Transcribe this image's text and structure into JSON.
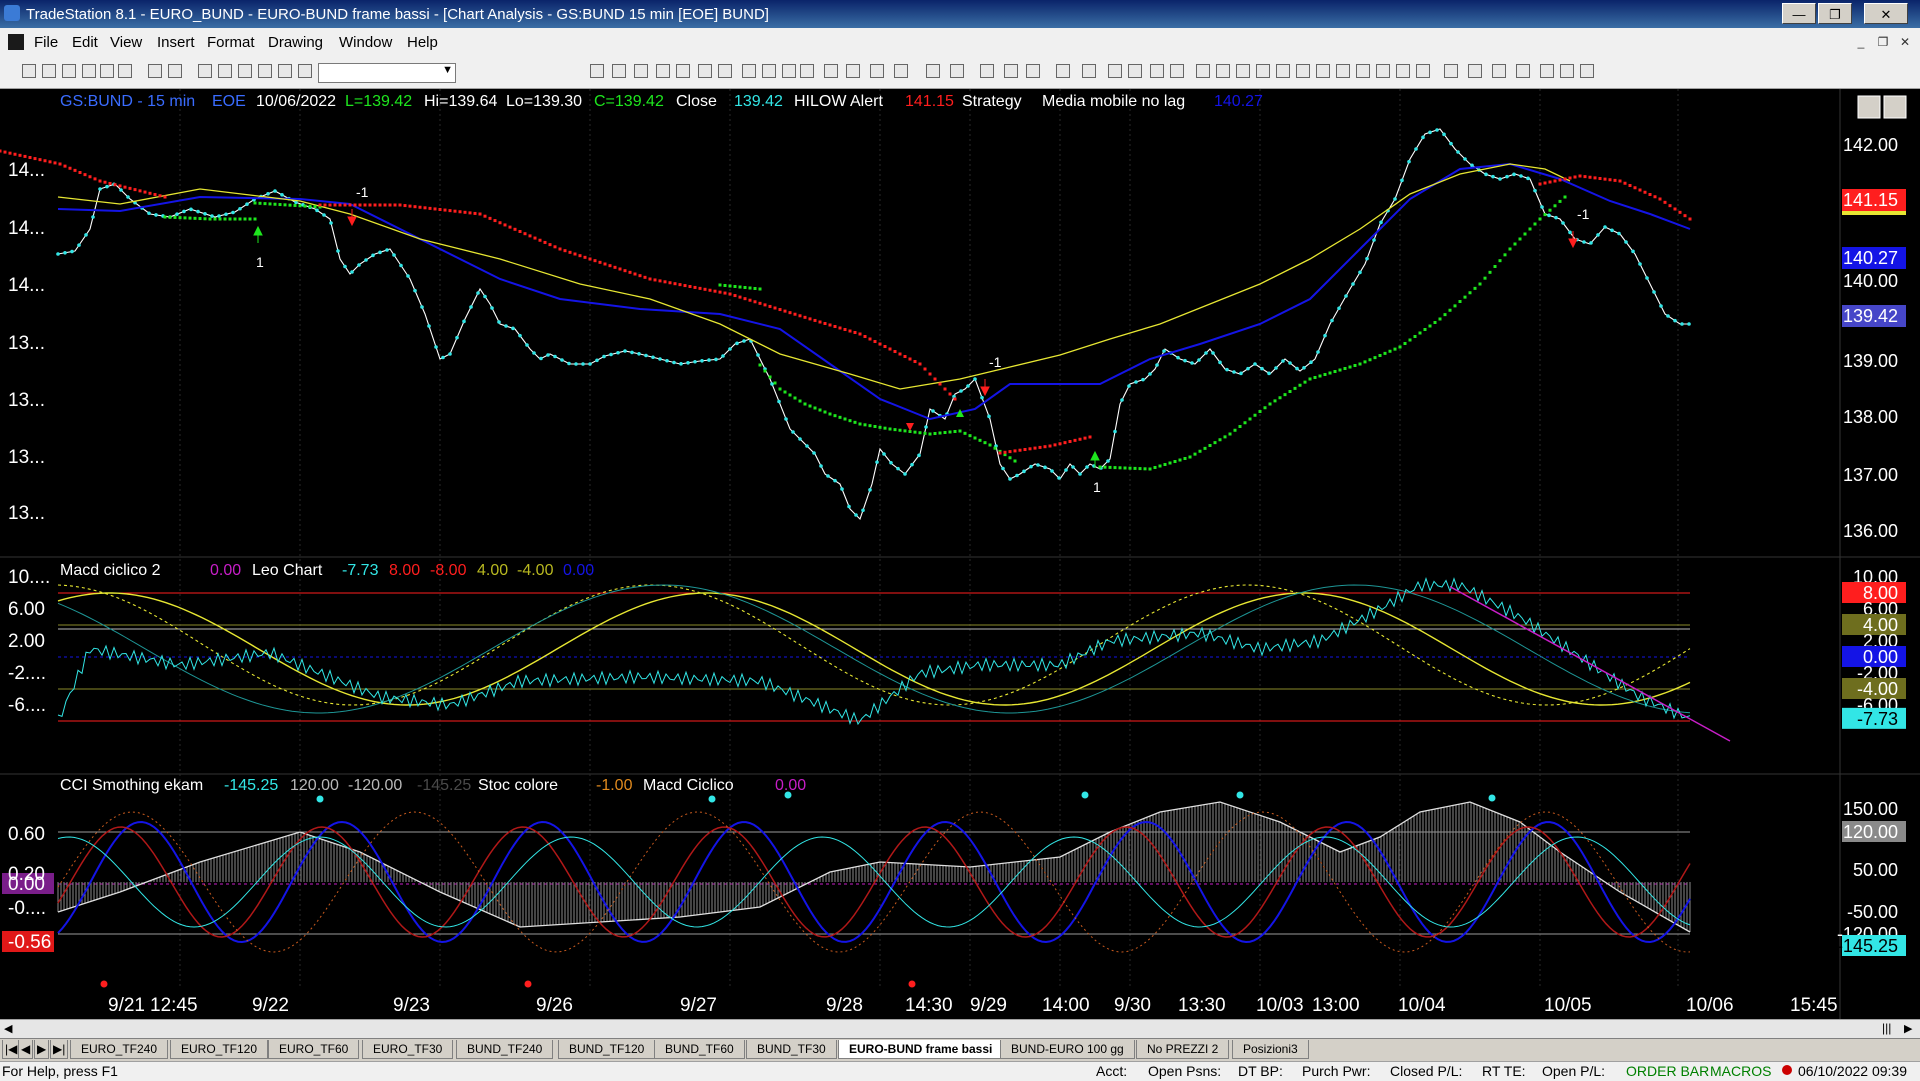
{
  "window": {
    "title": "TradeStation 8.1 - EURO_BUND - EURO-BUND frame bassi - [Chart Analysis - GS:BUND  15 min  [EOE] BUND]"
  },
  "menu": [
    "File",
    "Edit",
    "View",
    "Insert",
    "Format",
    "Drawing",
    "Window",
    "Help"
  ],
  "header": {
    "symbol": "GS:BUND - 15 min",
    "exchange": "EOE",
    "date": "10/06/2022",
    "last": "L=139.42",
    "high": "Hi=139.64",
    "low": "Lo=139.30",
    "close_eq": "C=139.42",
    "close_label": "Close",
    "close_val": "139.42",
    "hilow_label": "HILOW Alert",
    "hilow_val": "141.15",
    "strategy": "Strategy",
    "mm_label": "Media mobile no lag",
    "mm_val": "140.27"
  },
  "price_axis": {
    "labels": [
      "142.00",
      "141.15",
      "140.27",
      "140.00",
      "139.42",
      "139.00",
      "138.00",
      "137.00",
      "136.00"
    ],
    "left_labels": [
      "14...",
      "14...",
      "14...",
      "13...",
      "13...",
      "13...",
      "13..."
    ]
  },
  "macd_panel": {
    "title": "Macd ciclico 2",
    "v1": "0.00",
    "leo": "Leo Chart",
    "v2": "-7.73",
    "v3": "8.00",
    "v4": "-8.00",
    "v5": "4.00",
    "v6": "-4.00",
    "v7": "0.00",
    "axis": [
      "10.00",
      "8.00",
      "6.00",
      "4.00",
      "2.00",
      "0.00",
      "-2.00",
      "-4.00",
      "-6.00",
      "-7.73"
    ],
    "left_labels": [
      "10....",
      "6.00",
      "2.00",
      "-2....",
      "-6...."
    ]
  },
  "cci_panel": {
    "title": "CCI Smothing ekam",
    "v1": "-145.25",
    "v2": "120.00",
    "v3": "-120.00",
    "v4": "-145.25",
    "stoc": "Stoc colore",
    "stoc_val": "-1.00",
    "macd": "Macd Ciclico",
    "macd_val": "0.00",
    "axis": [
      "150.00",
      "120.00",
      "50.00",
      "-50.00",
      "-120.00",
      "-145.25"
    ],
    "left_labels": [
      "0.60",
      "0.20",
      "0.00",
      "-0....",
      "-0.56"
    ]
  },
  "time_axis": [
    "9/21",
    "12:45",
    "9/22",
    "9/23",
    "9/26",
    "9/27",
    "9/28",
    "14:30",
    "9/29",
    "14:00",
    "9/30",
    "13:30",
    "10/03",
    "13:00",
    "10/04",
    "10/05",
    "10/06",
    "15:45"
  ],
  "signals": [
    "1",
    "-1",
    "-1",
    "1",
    "-1"
  ],
  "tabs": [
    "EURO_TF240",
    "EURO_TF120",
    "EURO_TF60",
    "EURO_TF30",
    "BUND_TF240",
    "BUND_TF120",
    "BUND_TF60",
    "BUND_TF30",
    "EURO-BUND frame bassi",
    "BUND-EURO 100 gg",
    "No PREZZI 2",
    "Posizioni3"
  ],
  "status": {
    "help": "For Help, press F1",
    "acct": "Acct:",
    "open_psns": "Open Psns:",
    "dt_bp": "DT BP:",
    "purch_pwr": "Purch Pwr:",
    "closed_pl": "Closed P/L:",
    "rt_te": "RT TE:",
    "open_pl": "Open P/L:",
    "order_bar": "ORDER BAR",
    "macros": "MACROS",
    "datetime": "06/10/2022 09:39"
  },
  "colors": {
    "bg": "#000000",
    "blue": "#1414e6",
    "yellow": "#e6e632",
    "red": "#ff1e1e",
    "green": "#1ee61e",
    "cyan": "#32e6e6",
    "magenta": "#c81ec8",
    "teal": "#1e9696"
  }
}
